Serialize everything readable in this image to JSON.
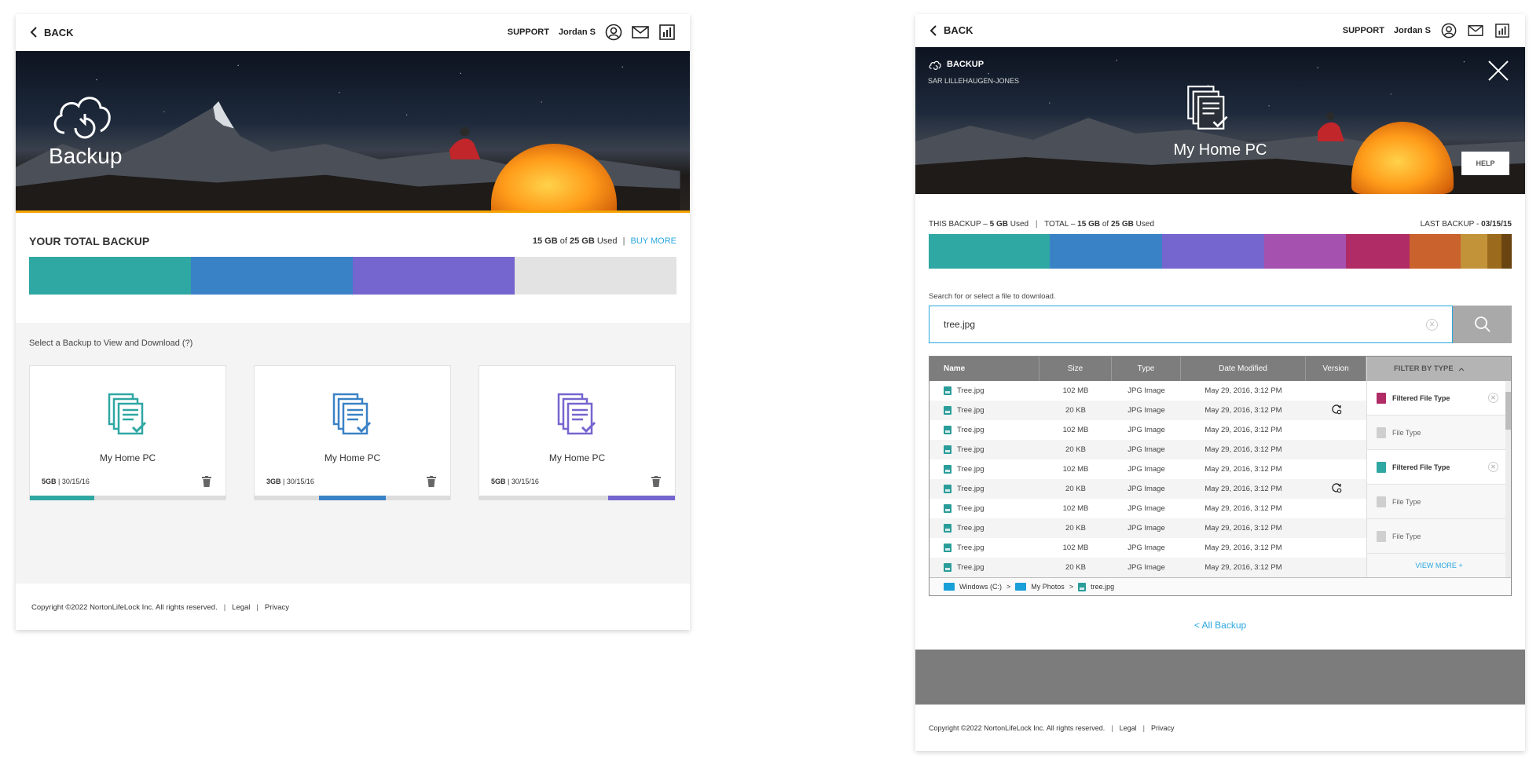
{
  "left": {
    "topbar": {
      "back": "BACK",
      "support": "SUPPORT",
      "user": "Jordan S"
    },
    "hero": {
      "title": "Backup"
    },
    "total": {
      "title": "YOUR TOTAL BACKUP",
      "used_amount": "15 GB",
      "of": "of",
      "total_amount": "25 GB",
      "used_word": "Used",
      "buy_more": "BUY MORE",
      "segments": [
        {
          "fraction": 0.25,
          "color": "#2fa7a3"
        },
        {
          "fraction": 0.25,
          "color": "#3a82c6"
        },
        {
          "fraction": 0.25,
          "color": "#7565cf"
        }
      ],
      "remainder_color": "#e3e3e3"
    },
    "select_label": "Select a Backup to View and Download (?)",
    "cards": [
      {
        "name": "My Home PC",
        "size": "5GB",
        "date": "30/15/16",
        "color": "#2fa7a3",
        "prog_start": 0.0,
        "prog_fraction": 0.33
      },
      {
        "name": "My Home PC",
        "size": "3GB",
        "date": "30/15/16",
        "color": "#3a82c6",
        "prog_start": 0.33,
        "prog_fraction": 0.34
      },
      {
        "name": "My Home PC",
        "size": "5GB",
        "date": "30/15/16",
        "color": "#7565cf",
        "prog_start": 0.66,
        "prog_fraction": 0.34
      }
    ],
    "footer": {
      "copyright": "Copyright ©2022 NortonLifeLock Inc. All rights reserved.",
      "legal": "Legal",
      "privacy": "Privacy"
    }
  },
  "right": {
    "topbar": {
      "back": "BACK",
      "support": "SUPPORT",
      "user": "Jordan S"
    },
    "hero": {
      "label": "BACKUP",
      "owner": "SAR LILLEHAUGEN-JONES",
      "name": "My Home PC",
      "help": "HELP"
    },
    "usage": {
      "this_backup_label": "THIS BACKUP –",
      "this_backup_amount": "5 GB",
      "this_used": "Used",
      "total_label": "TOTAL –",
      "total_used_amount": "15 GB",
      "of": "of",
      "total_amount": "25 GB",
      "total_used": "Used",
      "last_backup_label": "LAST BACKUP -",
      "last_backup_date": "03/15/15",
      "segments": [
        {
          "fraction": 0.207,
          "color": "#2fa7a3"
        },
        {
          "fraction": 0.193,
          "color": "#3a82c6"
        },
        {
          "fraction": 0.175,
          "color": "#7565cf"
        },
        {
          "fraction": 0.14,
          "color": "#a451b0"
        },
        {
          "fraction": 0.11,
          "color": "#b02c66"
        },
        {
          "fraction": 0.088,
          "color": "#c9622c"
        },
        {
          "fraction": 0.045,
          "color": "#c3933a"
        },
        {
          "fraction": 0.025,
          "color": "#9c6a1c"
        },
        {
          "fraction": 0.017,
          "color": "#6a4512"
        }
      ]
    },
    "search": {
      "label": "Search for or select a file to download.",
      "value": "tree.jpg"
    },
    "table": {
      "headers": {
        "name": "Name",
        "size": "Size",
        "type": "Type",
        "date": "Date Modified",
        "version": "Version"
      },
      "rows": [
        {
          "name": "Tree.jpg",
          "size": "102 MB",
          "type": "JPG Image",
          "date": "May 29, 2016, 3:12 PM",
          "version": false
        },
        {
          "name": "Tree.jpg",
          "size": "20 KB",
          "type": "JPG Image",
          "date": "May 29, 2016, 3:12 PM",
          "version": true
        },
        {
          "name": "Tree.jpg",
          "size": "102 MB",
          "type": "JPG Image",
          "date": "May 29, 2016, 3:12 PM",
          "version": false
        },
        {
          "name": "Tree.jpg",
          "size": "20 KB",
          "type": "JPG Image",
          "date": "May 29, 2016, 3:12 PM",
          "version": false
        },
        {
          "name": "Tree.jpg",
          "size": "102 MB",
          "type": "JPG Image",
          "date": "May 29, 2016, 3:12 PM",
          "version": false
        },
        {
          "name": "Tree.jpg",
          "size": "20 KB",
          "type": "JPG Image",
          "date": "May 29, 2016, 3:12 PM",
          "version": true
        },
        {
          "name": "Tree.jpg",
          "size": "102 MB",
          "type": "JPG Image",
          "date": "May 29, 2016, 3:12 PM",
          "version": false
        },
        {
          "name": "Tree.jpg",
          "size": "20 KB",
          "type": "JPG Image",
          "date": "May 29, 2016, 3:12 PM",
          "version": false
        },
        {
          "name": "Tree.jpg",
          "size": "102 MB",
          "type": "JPG Image",
          "date": "May 29, 2016, 3:12 PM",
          "version": false
        },
        {
          "name": "Tree.jpg",
          "size": "20 KB",
          "type": "JPG Image",
          "date": "May 29, 2016, 3:12 PM",
          "version": false
        }
      ]
    },
    "filter": {
      "title": "FILTER BY TYPE",
      "items": [
        {
          "label": "Filtered File Type",
          "active": true,
          "color": "#b02c66"
        },
        {
          "label": "File Type",
          "active": false,
          "color": "#cfcfcf"
        },
        {
          "label": "Filtered File Type",
          "active": true,
          "color": "#2fa7a3"
        },
        {
          "label": "File Type",
          "active": false,
          "color": "#cfcfcf"
        },
        {
          "label": "File Type",
          "active": false,
          "color": "#cfcfcf"
        }
      ],
      "view_more": "VIEW MORE +"
    },
    "breadcrumb": {
      "drive": "Windows (C:)",
      "folder": "My Photos",
      "file": "tree.jpg",
      "sep": ">"
    },
    "all_backup": "< All Backup",
    "footer": {
      "copyright": "Copyright ©2022 NortonLifeLock Inc. All rights reserved.",
      "legal": "Legal",
      "privacy": "Privacy"
    }
  }
}
